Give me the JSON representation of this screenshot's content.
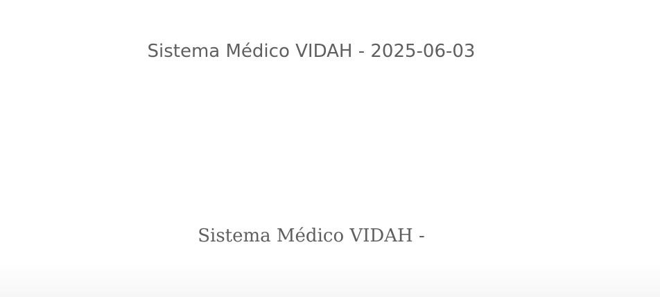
{
  "header": {
    "title": "Sistema Médico VIDAH - 2025-06-03"
  },
  "footer": {
    "title": "Sistema Médico VIDAH -"
  },
  "colors": {
    "text": "#5f5f5f",
    "background": "#ffffff"
  }
}
